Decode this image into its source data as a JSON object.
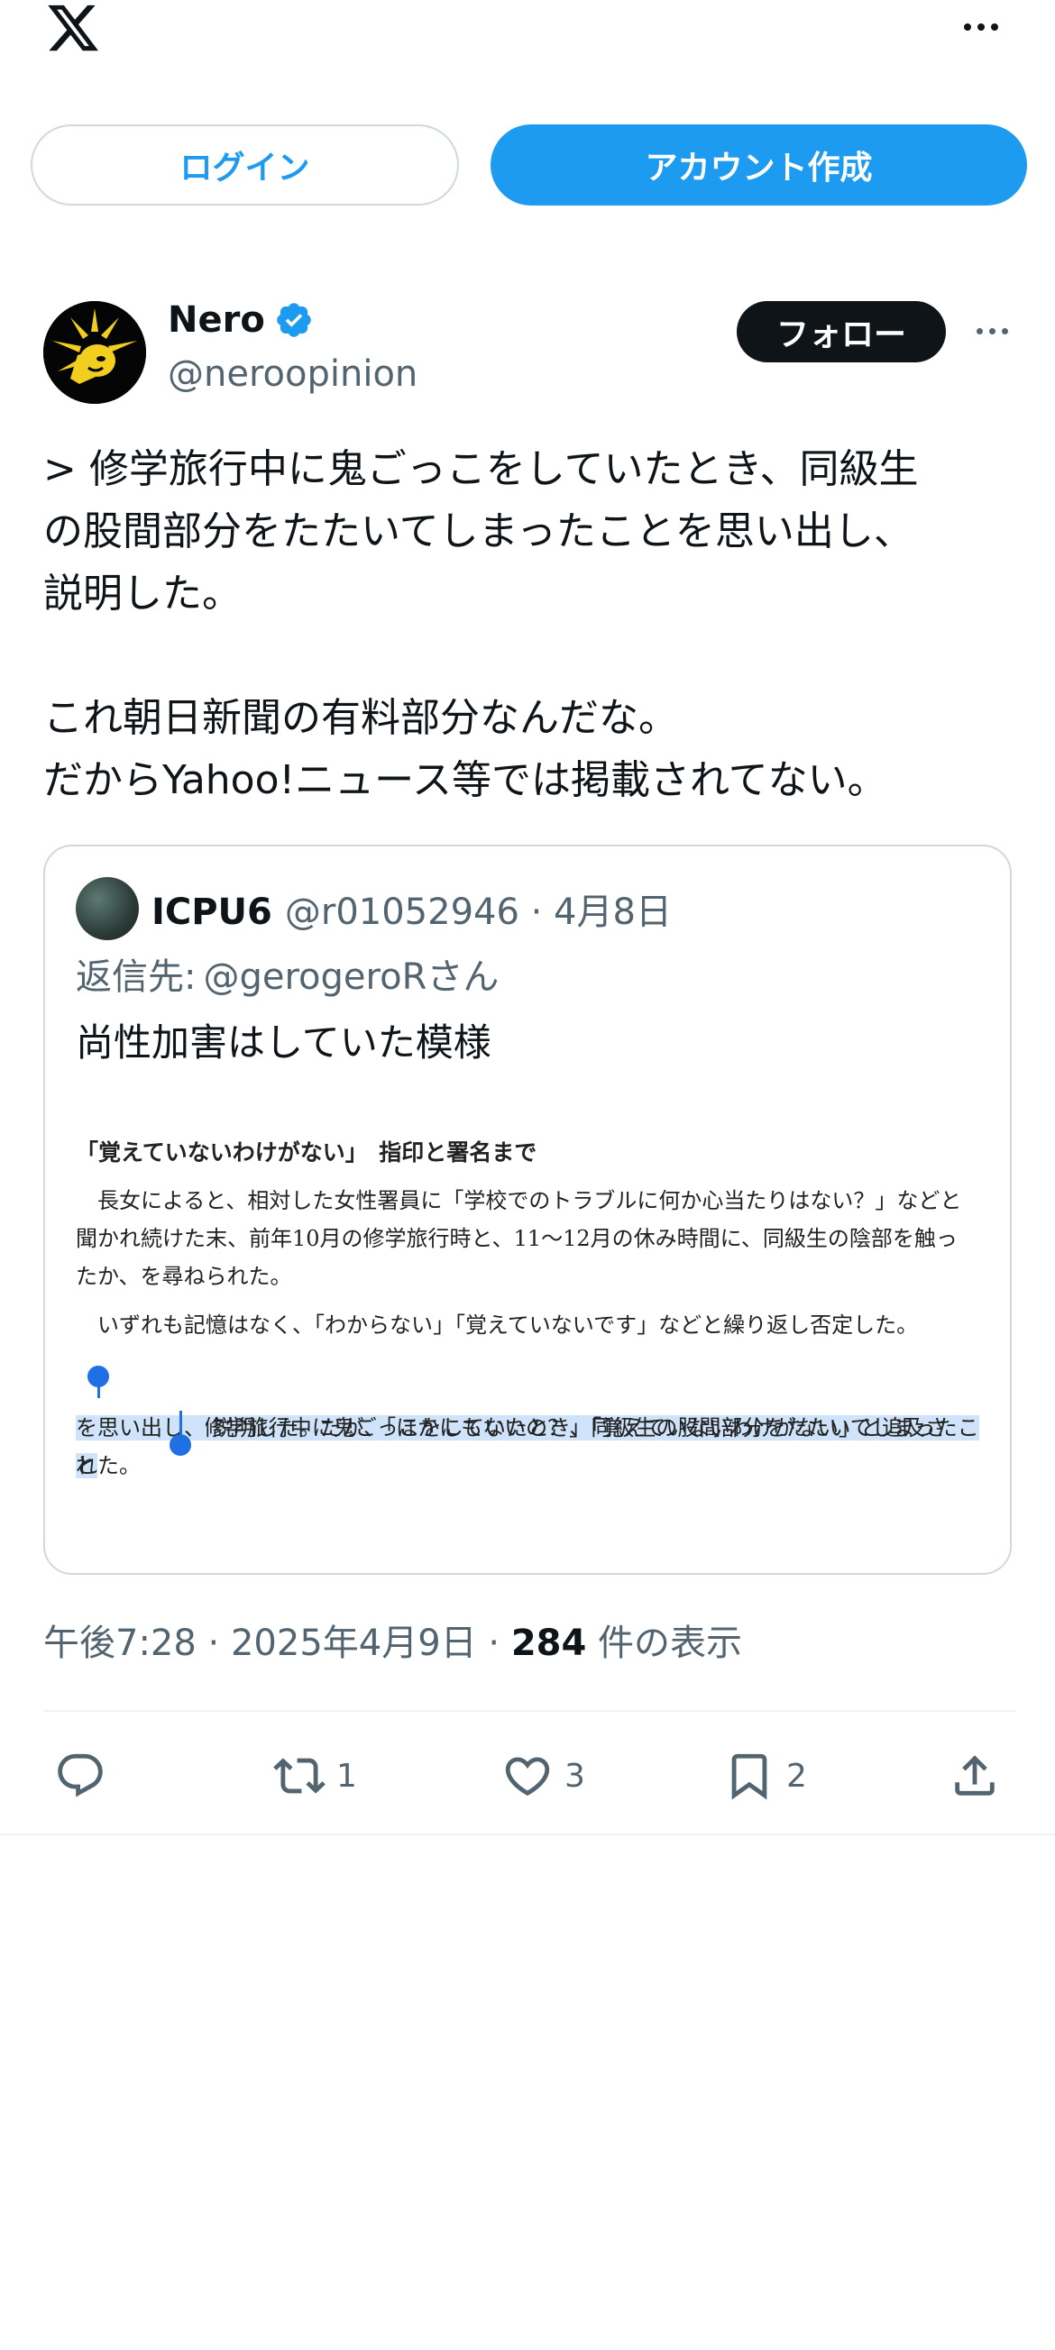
{
  "topbar": {
    "logo_icon": "x-logo-icon",
    "more_icon": "more-icon"
  },
  "auth": {
    "login_label": "ログイン",
    "signup_label": "アカウント作成"
  },
  "post": {
    "author_name": "Nero",
    "author_handle": "@neroopinion",
    "verified": true,
    "follow_label": "フォロー",
    "text": "> 修学旅行中に鬼ごっこをしていたとき、同級生\nの股間部分をたたいてしまったことを思い出し、\n説明した。\n\nこれ朝日新聞の有料部分なんだな。\nだからYahoo!ニュース等では掲載されてない。"
  },
  "quote": {
    "name": "ICPU6",
    "meta": "@r01052946 · 4月8日",
    "reply_prefix": "返信先:",
    "reply_to": "@gerogeroRさん",
    "text": "尚性加害はしていた模様",
    "article": {
      "title": "「覚えていないわけがない」　指印と署名まで",
      "p1": "　長女によると、相対した女性署員に「学校でのトラブルに何か心当たりはない？」などと\n聞かれ続けた末、前年10月の修学旅行時と、11〜12月の休み時間に、同級生の陰部を触っ\nたか、を尋ねられた。",
      "p2": "　いずれも記憶はなく、「わからない」「覚えていないです」などと繰り返し否定した。",
      "p3_highlight_1": "　途中、修学旅行中に鬼ごっこをしていたとき、同級生の股間部分をたたいてしまったこと",
      "p3_highlight_2": "を思い出し、",
      "p3_rest": "説明した。だが、「ほかにもないの？」「覚えていないわけがない」と追及さ",
      "p3_last": "れた。"
    }
  },
  "timestamp": {
    "time_date": "午後7:28 · 2025年4月9日 · ",
    "views_count": "284",
    "views_label": " 件の表示"
  },
  "actions": {
    "reply_count": "",
    "repost_count": "1",
    "like_count": "3",
    "bookmark_count": "2"
  },
  "colors": {
    "accent": "#1d9bf0",
    "text": "#0f1419",
    "secondary": "#536471",
    "border": "#cfd9de"
  }
}
